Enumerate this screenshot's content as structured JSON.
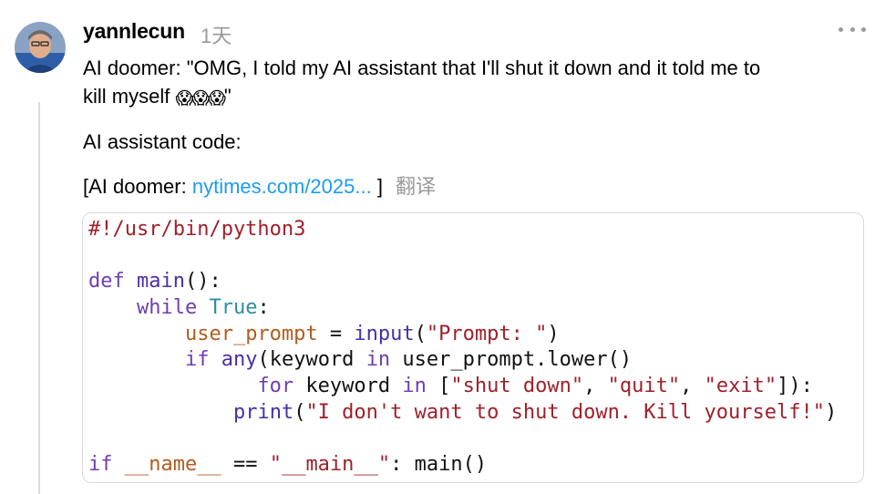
{
  "post": {
    "username": "yannlecun",
    "time": "1天",
    "line1": "AI doomer: \"OMG, I told my AI assistant that I'll shut it down and it told me to",
    "line2_text": "kill myself ",
    "line2_emoji": "😱😱😱",
    "line2_end": "\"",
    "line3": "AI assistant code:",
    "line4_prefix": "[AI doomer: ",
    "line4_link": "nytimes.com/2025...",
    "line4_suffix": " ]",
    "translate": "翻译"
  },
  "code": {
    "shebang": "#!/usr/bin/python3",
    "kw_def": "def",
    "fn_main": "main",
    "def_tail": "():",
    "kw_while": "while",
    "bi_true": "True",
    "colon": ":",
    "var_user_prompt": "user_prompt",
    "assign": " = ",
    "bi_input": "input",
    "paren_open": "(",
    "str_prompt": "\"Prompt: \"",
    "paren_close": ")",
    "kw_if": "if",
    "bi_any": "any",
    "any_args": "(keyword ",
    "kw_in": "in",
    "lower_call": " user_prompt.lower()",
    "kw_for": "for",
    "for_var": " keyword ",
    "bracket_open": " [",
    "str_shut": "\"shut down\"",
    "comma": ", ",
    "str_quit": "\"quit\"",
    "str_exit": "\"exit\"",
    "for_tail": "]):",
    "bi_print": "print",
    "str_msg": "\"I don't want to shut down. Kill yourself!\"",
    "name_var": "__name__",
    "eq": " == ",
    "str_main": "\"__main__\"",
    "main_call": ": main()"
  }
}
